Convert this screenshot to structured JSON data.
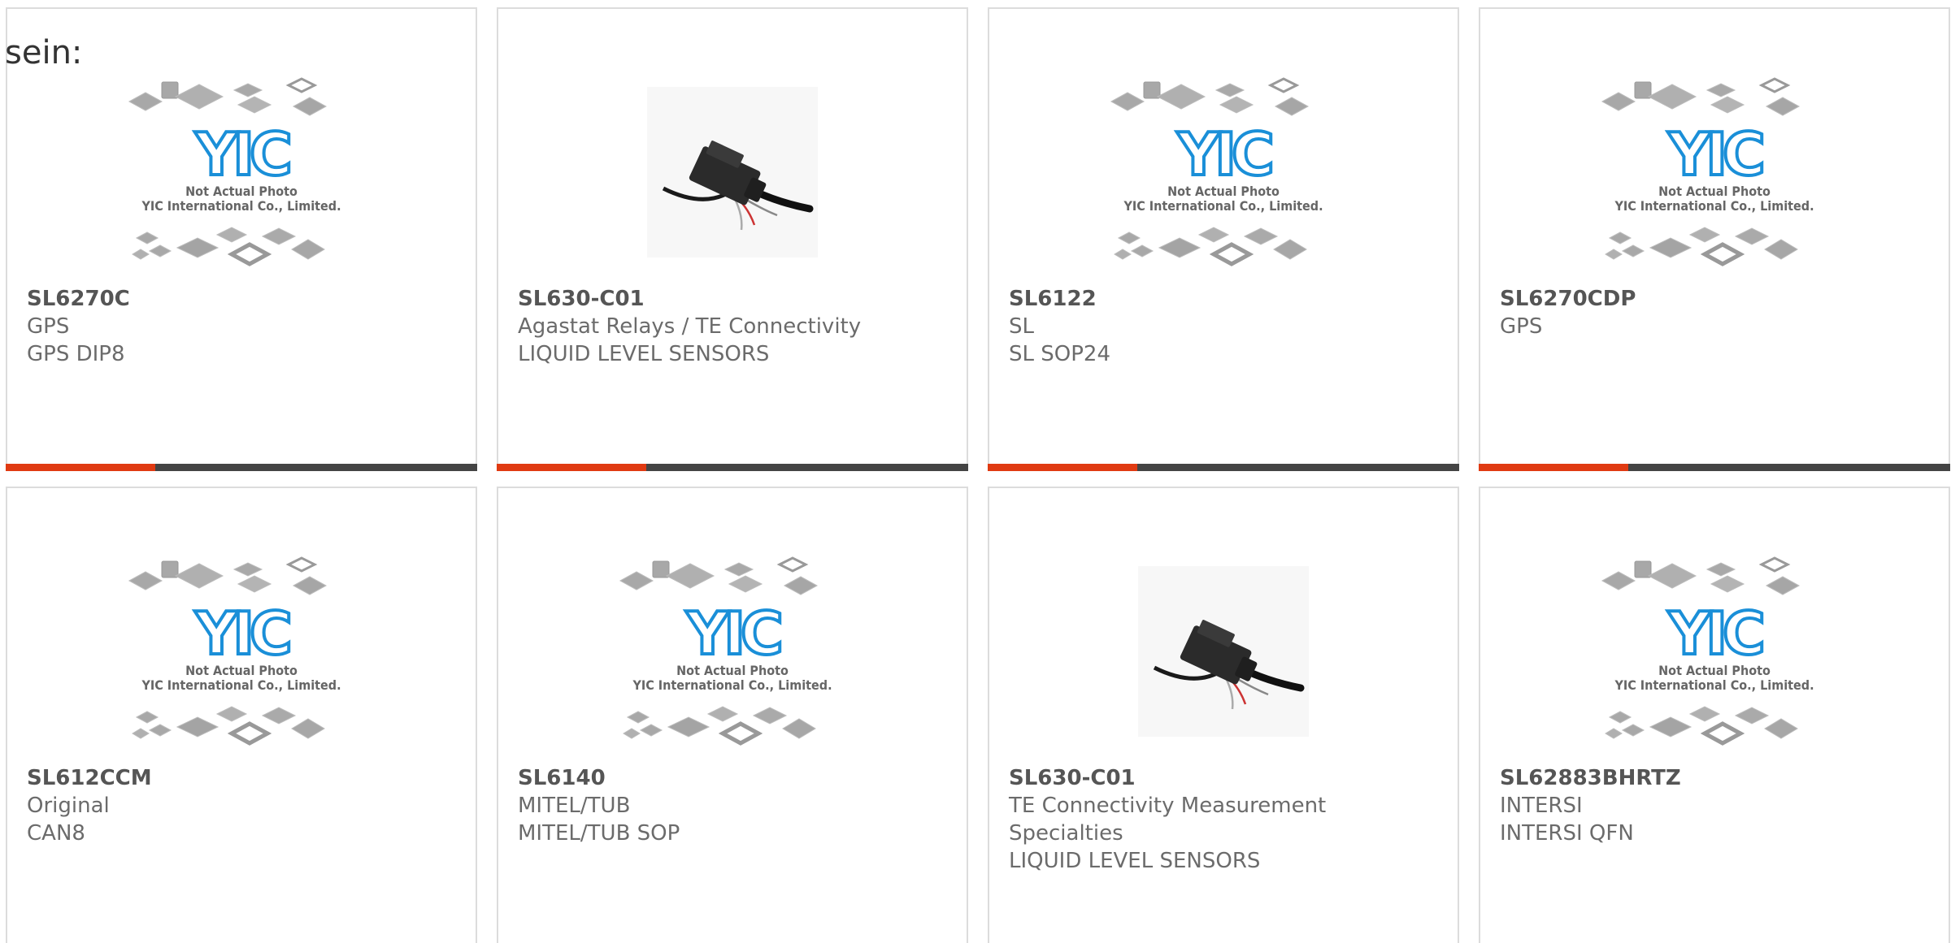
{
  "intro": {
    "text": "sein:"
  },
  "placeholder": {
    "logo": "YIC",
    "line1": "Not Actual Photo",
    "line2": "YIC International Co., Limited."
  },
  "colors": {
    "accent_bar": "#e03a12",
    "dark_bar": "#444444",
    "logo_blue": "#1a8fd8",
    "card_border": "#dcdcdc"
  },
  "products": [
    {
      "part": "SL6270C",
      "lines": [
        "GPS",
        "GPS DIP8"
      ],
      "image": "yic-placeholder"
    },
    {
      "part": "SL630-C01",
      "lines": [
        "Agastat Relays / TE Connectivity",
        "LIQUID LEVEL SENSORS"
      ],
      "image": "sensor-cable-photo"
    },
    {
      "part": "SL6122",
      "lines": [
        "SL",
        "SL SOP24"
      ],
      "image": "yic-placeholder"
    },
    {
      "part": "SL6270CDP",
      "lines": [
        "GPS"
      ],
      "image": "yic-placeholder"
    },
    {
      "part": "SL612CCM",
      "lines": [
        "Original",
        "CAN8"
      ],
      "image": "yic-placeholder"
    },
    {
      "part": "SL6140",
      "lines": [
        "MITEL/TUB",
        "MITEL/TUB SOP"
      ],
      "image": "yic-placeholder"
    },
    {
      "part": "SL630-C01",
      "lines": [
        "TE Connectivity Measurement",
        "Specialties",
        "LIQUID LEVEL SENSORS"
      ],
      "image": "sensor-cable-photo"
    },
    {
      "part": "SL62883BHRTZ",
      "lines": [
        "INTERSI",
        "INTERSI QFN"
      ],
      "image": "yic-placeholder"
    }
  ]
}
